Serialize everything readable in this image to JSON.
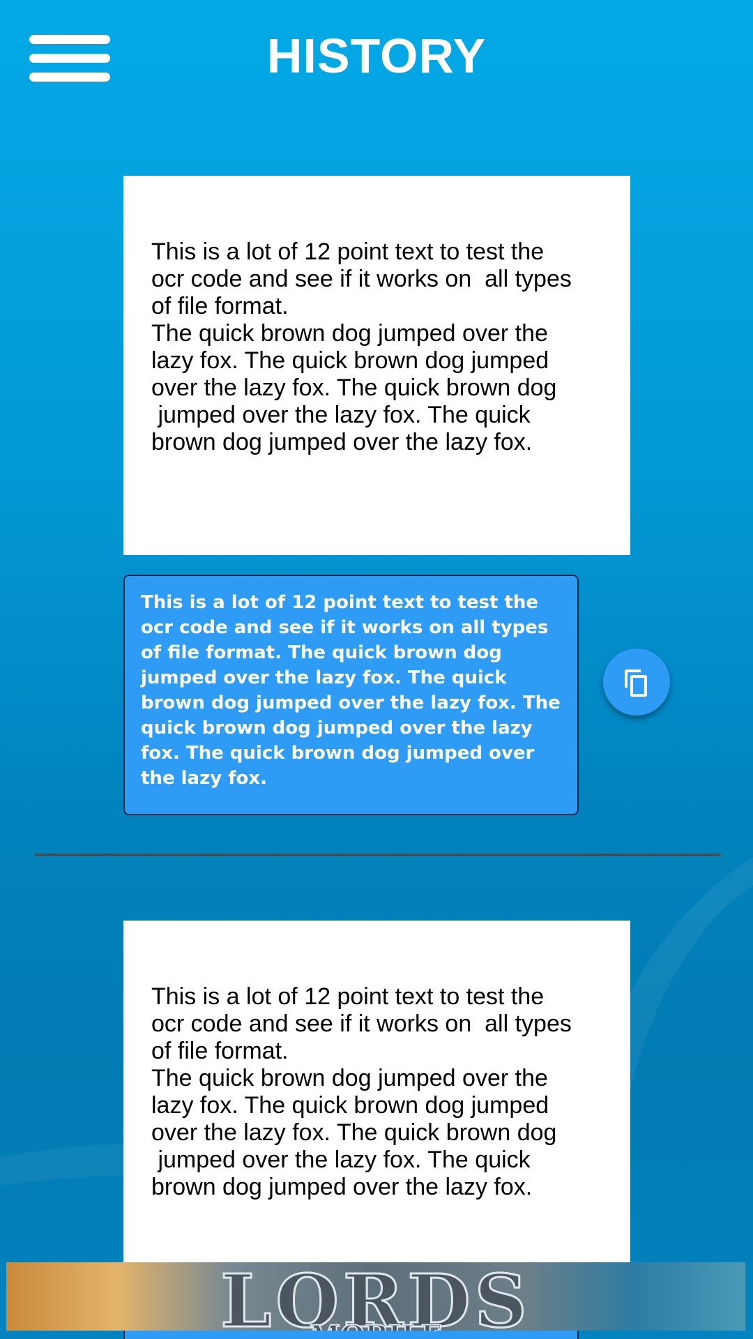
{
  "header": {
    "title": "HISTORY",
    "menu_icon": "hamburger-menu-icon"
  },
  "history": [
    {
      "scan_lines": [
        "This is a lot of 12 point text to test the",
        "ocr code and see if it works on  all types",
        "of file format.",
        "The quick brown dog jumped over the",
        "lazy fox. The quick brown dog jumped",
        "over the lazy fox. The quick brown dog",
        " jumped over the lazy fox. The quick",
        "brown dog jumped over the lazy fox."
      ],
      "result_lines": [
        "This is a lot of 12 point text to test the",
        "ocr code and see if it works on all types",
        "of file format. The quick brown dog",
        "jumped over the lazy fox. The quick",
        "brown dog jumped over the lazy fox. The",
        "quick brown dog jumped over the lazy",
        "fox. The quick brown dog jumped over",
        "the lazy fox."
      ],
      "copy_icon": "copy-icon"
    },
    {
      "scan_lines": [
        "This is a lot of 12 point text to test the",
        "ocr code and see if it works on  all types",
        "of file format.",
        "The quick brown dog jumped over the",
        "lazy fox. The quick brown dog jumped",
        "over the lazy fox. The quick brown dog",
        " jumped over the lazy fox. The quick",
        "brown dog jumped over the lazy fox."
      ]
    }
  ],
  "ad": {
    "text": "LORDS",
    "sub": "MOBILE"
  },
  "colors": {
    "background": "#03a9e6",
    "card": "#2e9cf5",
    "scan_bg": "#ffffff",
    "divider": "#3b4b57"
  }
}
